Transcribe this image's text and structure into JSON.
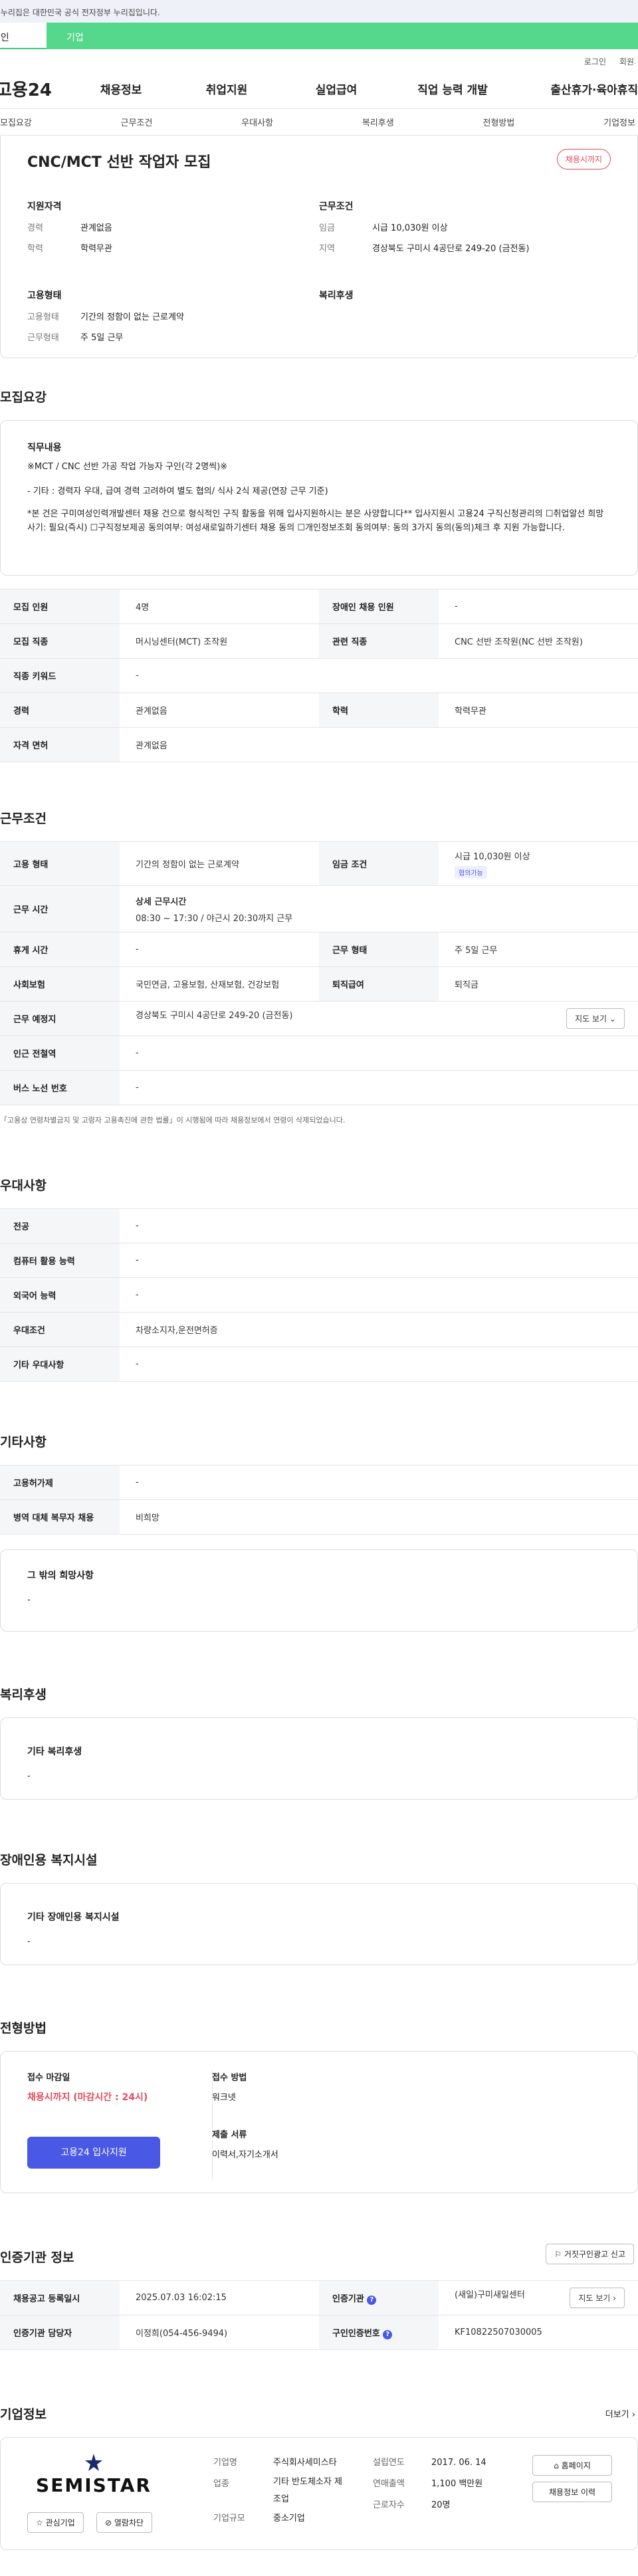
{
  "gov_notice": "이 누리집은 대한민국 공식 전자정부 누리집입니다.",
  "tabs": [
    "개인",
    "기업"
  ],
  "util": [
    "로그인",
    "회원가입"
  ],
  "logo": "고용24",
  "gnb": [
    "채용정보",
    "취업지원",
    "실업급여",
    "직업 능력 개발",
    "출산휴가·육아휴직"
  ],
  "lnb": [
    "모집요강",
    "근무조건",
    "우대사항",
    "복리후생",
    "전형방법",
    "기업정보"
  ],
  "job": {
    "title": "CNC/MCT 선반 작업자 모집",
    "deadline_badge": "채용시까지",
    "qual_title": "지원자격",
    "career_k": "경력",
    "career_v": "관계없음",
    "edu_k": "학력",
    "edu_v": "학력무관",
    "cond_title": "근무조건",
    "wage_k": "임금",
    "wage_v": "시급 10,030원 이상",
    "loc_k": "지역",
    "loc_v": "경상북도 구미시 4공단로 249-20 (금전동)",
    "emp_title": "고용형태",
    "emptype_k": "고용형태",
    "emptype_v": "기간의 정함이 없는 근로계약",
    "workform_k": "근무형태",
    "workform_v": "주 5일 근무",
    "welfare_title": "복리후생"
  },
  "recruit": {
    "title": "모집요강",
    "duty_title": "직무내용",
    "duty_l1": "※MCT / CNC 선반 가공 작업 가능자 구인(각 2명씩)※",
    "duty_l2": "- 기타 : 경력자 우대, 급여 경력 고려하여 별도 협의/ 식사 2식 제공(연장 근무 기준)",
    "duty_l3": "*본 건은 구미여성인력개발센터 채용 건으로 형식적인 구직 활동을 위해 입사지원하시는 분은 사양합니다** 입사지원시 고용24 구직신청관리의 ☐취업알선 희망사기: 필요(즉시) ☐구직정보제공 동의여부: 여성새로일하기센터 채용 동의 ☐개인정보조회 동의여부: 동의 3가지 동의(동의)체크 후 지원 가능합니다.",
    "rows": [
      [
        "모집 인원",
        "4명",
        "장애인 채용 인원",
        "-"
      ],
      [
        "모집 직종",
        "머시닝센터(MCT) 조작원",
        "관련 직종",
        "CNC 선반 조작원(NC 선반 조작원)"
      ],
      [
        "직종 키워드",
        "-",
        "",
        ""
      ],
      [
        "경력",
        "관계없음",
        "학력",
        "학력무관"
      ],
      [
        "자격 면허",
        "관계없음",
        "",
        ""
      ]
    ]
  },
  "work": {
    "title": "근무조건",
    "emp_k": "고용 형태",
    "emp_v": "기간의 정함이 없는 근로계약",
    "wage_k": "임금 조건",
    "wage_v": "시급 10,030원 이상",
    "wage_badge": "협의가능",
    "time_k": "근무 시간",
    "time_sub": "상세 근무시간",
    "time_v": "08:30 ~ 17:30 / 야근시 20:30까지 근무",
    "rest_k": "휴게 시간",
    "rest_v": "-",
    "form_k": "근무 형태",
    "form_v": "주 5일 근무",
    "ins_k": "사회보험",
    "ins_v": "국민연금, 고용보험, 산재보험, 건강보험",
    "sev_k": "퇴직급여",
    "sev_v": "퇴직금",
    "place_k": "근무 예정지",
    "place_v": "경상북도 구미시 4공단로 249-20 (금전동)",
    "map_btn": "지도 보기",
    "sub_k": "인근 전철역",
    "sub_v": "-",
    "bus_k": "버스 노선 번호",
    "bus_v": "-",
    "note": "「고용상 연령차별금지 및 고령자 고용촉진에 관한 법률」이 시행됨에 따라 채용정보에서 연령이 삭제되었습니다."
  },
  "pref": {
    "title": "우대사항",
    "rows": [
      [
        "전공",
        "-"
      ],
      [
        "컴퓨터 활용 능력",
        "-"
      ],
      [
        "외국어 능력",
        "-"
      ],
      [
        "우대조건",
        "차량소지자,운전면허증"
      ],
      [
        "기타 우대사항",
        "-"
      ]
    ]
  },
  "etc": {
    "title": "기타사항",
    "rows": [
      [
        "고용허가제",
        "-"
      ],
      [
        "병역 대체 복무자 채용",
        "비희망"
      ]
    ],
    "wish_title": "그 밖의 희망사항",
    "wish_v": "-"
  },
  "welfare": {
    "title": "복리후생",
    "box_title": "기타 복리후생",
    "box_v": "-"
  },
  "disabled": {
    "title": "장애인용 복지시설",
    "box_title": "기타 장애인용 복지시설",
    "box_v": "-"
  },
  "process": {
    "title": "전형방법",
    "deadline_k": "접수 마감일",
    "deadline_v": "채용시까지 (마감시간 : 24시)",
    "method_k": "접수 방법",
    "method_v": "워크넷",
    "apply_btn": "고용24 입사지원",
    "docs_k": "제출 서류",
    "docs_v": "이력서,자기소개서"
  },
  "cert": {
    "title": "인증기관 정보",
    "report_btn": "거짓구인광고 신고",
    "reg_k": "채용공고 등록일시",
    "reg_v": "2025.07.03 16:02:15",
    "org_k": "인증기관",
    "org_v": "(새일)구미새일센터",
    "map_btn": "지도 보기",
    "mgr_k": "인증기관 담당자",
    "mgr_v": "이정희(054-456-9494)",
    "cid_k": "구인인증번호",
    "cid_v": "KF10822507030005"
  },
  "company": {
    "title": "기업정보",
    "more": "더보기",
    "logo_text": "SEMISTAR",
    "fav_btn": "관심기업",
    "block_btn": "열람차단",
    "name_k": "기업명",
    "name_v": "주식회사세미스타",
    "ind_k": "업종",
    "ind_v": "기타 반도체소자 제조업",
    "size_k": "기업규모",
    "size_v": "중소기업",
    "est_k": "설립연도",
    "est_v": "2017. 06. 14",
    "sales_k": "연매출액",
    "sales_v": "1,100 백만원",
    "emp_k": "근로자수",
    "emp_v": "20명",
    "home_btn": "홈페이지",
    "hist_btn": "채용정보 이력"
  }
}
